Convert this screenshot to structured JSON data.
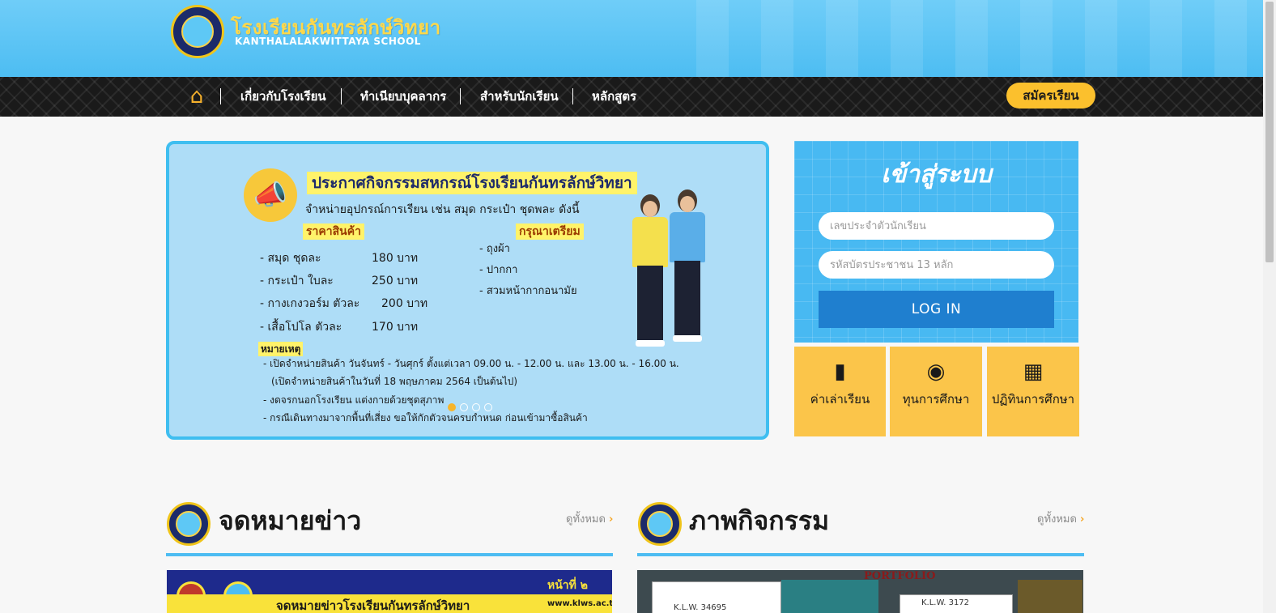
{
  "header": {
    "school_name_thai": "โรงเรียนกันทรลักษ์วิทยา",
    "school_name_en": "KANTHALALAKWITTAYA SCHOOL"
  },
  "nav": {
    "home_icon": "home-icon",
    "items": [
      "เกี่ยวกับโรงเรียน",
      "ทำเนียบบุคลากร",
      "สำหรับนักเรียน",
      "หลักสูตร"
    ],
    "apply_label": "สมัครเรียน"
  },
  "banner": {
    "title": "ประกาศกิจกรรมสหกรณ์โรงเรียนกันทรลักษ์วิทยา",
    "subtitle": "จำหน่ายอุปกรณ์การเรียน เช่น สมุด กระเป๋า ชุดพละ ดังนี้",
    "price_heading": "ราคาสินค้า",
    "prices": [
      {
        "item": "- สมุด ชุดละ",
        "price": "180 บาท"
      },
      {
        "item": "- กระเป๋า ใบละ",
        "price": "250 บาท"
      },
      {
        "item": "- กางเกงวอร์ม ตัวละ",
        "price": "200 บาท"
      },
      {
        "item": "- เสื้อโปโล ตัวละ",
        "price": "170 บาท"
      }
    ],
    "prepare_heading": "กรุณาเตรียม",
    "prepare": [
      "- ถุงผ้า",
      "- ปากกา",
      "- สวมหน้ากากอนามัย"
    ],
    "note_heading": "หมายเหตุ",
    "notes": [
      "- เปิดจำหน่ายสินค้า วันจันทร์ - วันศุกร์ ตั้งแต่เวลา 09.00 น. - 12.00 น. และ 13.00 น. - 16.00 น.",
      "(เปิดจำหน่ายสินค้าในวันที่ 18 พฤษภาคม 2564 เป็นต้นไป)",
      "- งดจรกนอกโรงเรียน  แต่งกายด้วยชุดสุภาพ",
      "- กรณีเดินทางมาจากพื้นที่เสี่ยง ขอให้กักตัวจนครบกำหนด ก่อนเข้ามาซื้อสินค้า"
    ],
    "slide_count": 4,
    "active_slide": 1
  },
  "login": {
    "title": "เข้าสู่ระบบ",
    "student_id_placeholder": "เลขประจำตัวนักเรียน",
    "citizen_id_placeholder": "รหัสบัตรประชาชน 13 หลัก",
    "button_label": "LOG IN"
  },
  "tiles": [
    {
      "icon": "credit-card-icon",
      "label": "ค่าเล่าเรียน"
    },
    {
      "icon": "coins-icon",
      "label": "ทุนการศึกษา"
    },
    {
      "icon": "calendar-icon",
      "label": "ปฏิทินการศึกษา"
    }
  ],
  "sections": {
    "news": {
      "title": "จดหมายข่าว",
      "see_all": "ดูทั้งหมด",
      "thumb_caption": "จดหมายข่าวโรงเรียนกันทรลักษ์วิทยา",
      "thumb_url": "www.klws.ac.th",
      "thumb_page": "หน้าที่ ๒"
    },
    "gallery": {
      "title": "ภาพกิจกรรม",
      "see_all": "ดูทั้งหมด",
      "thumb_label": "PORTFOLIO",
      "thumb_card_1": "K.L.W. 34695",
      "thumb_card_2": "K.L.W. 3172"
    }
  },
  "colors": {
    "header_blue": "#4dbdf2",
    "accent_yellow": "#fbc02d",
    "tile_yellow": "#fbc54a",
    "login_button": "#1f7fcf",
    "nav_dark": "#1a1a1a"
  }
}
